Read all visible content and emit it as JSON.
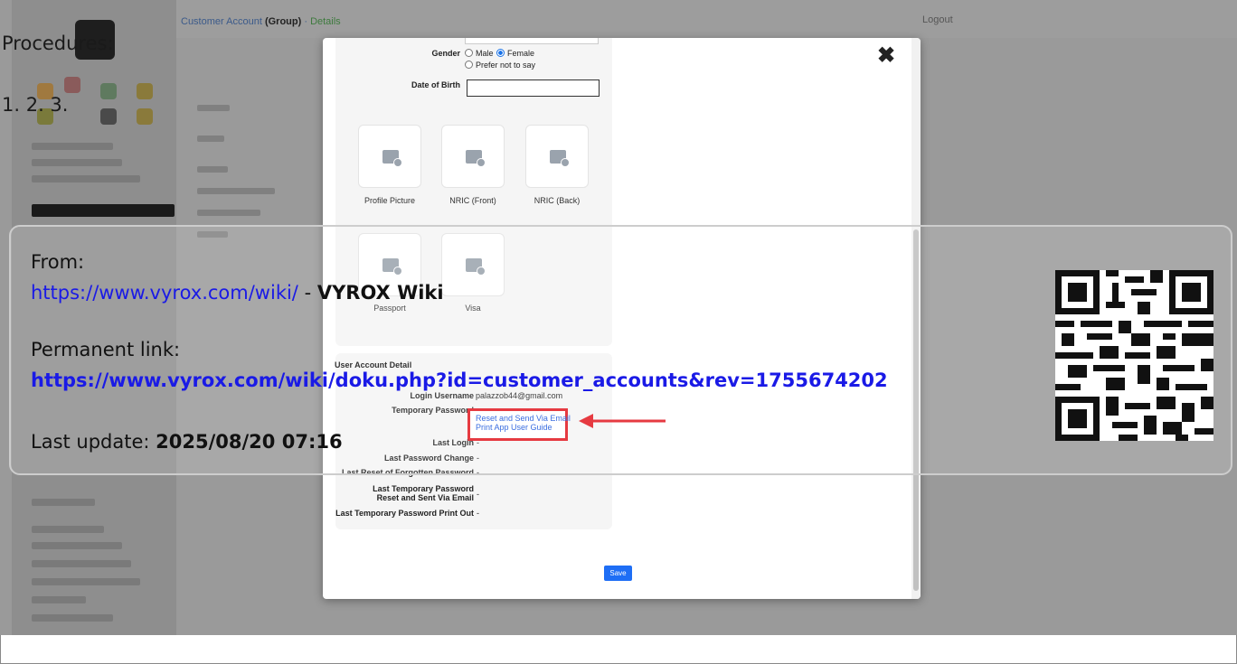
{
  "background": {
    "breadcrumb": {
      "link": "Customer Account",
      "bold": "(Group)",
      "sep": "·",
      "status": "Details"
    },
    "userbar": "Logout"
  },
  "procedures": {
    "title": "Procedures:",
    "steps": "1. 2. 3."
  },
  "modal": {
    "close_icon": "close-icon",
    "gender": {
      "label": "Gender",
      "options": [
        "Male",
        "Female",
        "Prefer not to say"
      ],
      "selected": "Female"
    },
    "dob": {
      "label": "Date of Birth",
      "value": ""
    },
    "uploads": [
      "Profile Picture",
      "NRIC (Front)",
      "NRIC (Back)",
      "Passport",
      "Visa"
    ],
    "account": {
      "title": "User Account Detail",
      "login_username_label": "Login Username",
      "login_username_value": "palazzob44@gmail.com",
      "temp_password_label": "Temporary Password",
      "reset_link": "Reset and Send Via Email",
      "print_link": "Print App User Guide",
      "rows": [
        {
          "label": "Last Login",
          "value": "-"
        },
        {
          "label": "Last Password Change",
          "value": "-"
        },
        {
          "label": "Last Reset of Forgotten Password",
          "value": "-"
        },
        {
          "label": "Last Temporary Password Reset and Sent Via Email",
          "value": "-"
        },
        {
          "label": "Last Temporary Password Print Out",
          "value": "-"
        }
      ]
    },
    "save_label": "Save"
  },
  "info": {
    "from_label": "From:",
    "wiki_url": "https://www.vyrox.com/wiki/",
    "dash": " - ",
    "wiki_name": "VYROX Wiki",
    "permalink_label": "Permanent link:",
    "permalink": "https://www.vyrox.com/wiki/doku.php?id=customer_accounts&rev=1755674202",
    "last_update_label": "Last update: ",
    "last_update": "2025/08/20 07:16"
  },
  "colors": {
    "link": "#1a1ae6",
    "highlight": "#e21a22",
    "primary": "#1e6ef5"
  }
}
